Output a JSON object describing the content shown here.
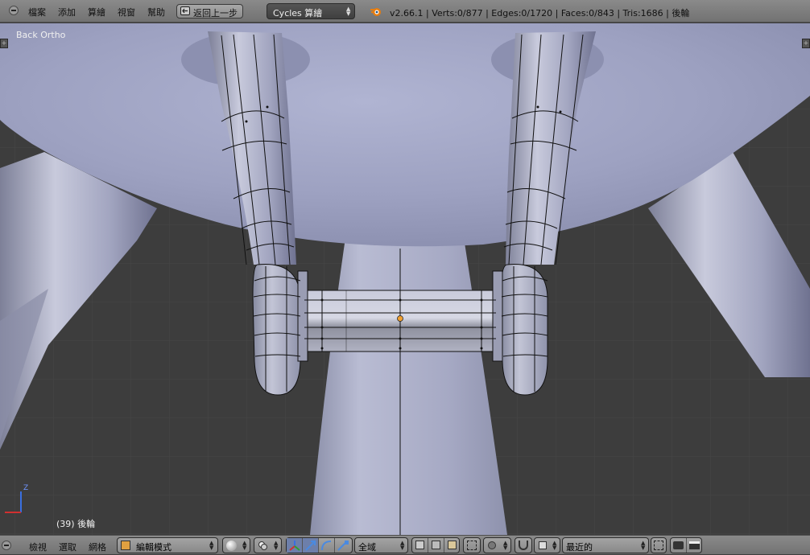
{
  "header": {
    "menus": [
      "檔案",
      "添加",
      "算繪",
      "視窗",
      "幫助"
    ],
    "back_button_label": "返回上一步",
    "render_engine": "Cycles 算繪",
    "stats": "v2.66.1 | Verts:0/877 | Edges:0/1720 | Faces:0/843 | Tris:1686 | 後輪"
  },
  "viewport": {
    "view_name": "Back Ortho",
    "object_info": "(39) 後輪",
    "axis_label": "Z",
    "colors": {
      "background": "#3d3d3d",
      "grid": "#474747",
      "mesh": "#a3a7c6",
      "wire": "#101010",
      "origin": "#f0a030"
    }
  },
  "bottom": {
    "menus": [
      "檢視",
      "選取",
      "網格"
    ],
    "mode": "編輯模式",
    "pivot_icon": "pivot-dot-icon",
    "transform_orientation": "全域",
    "snap_target": "最近的"
  }
}
